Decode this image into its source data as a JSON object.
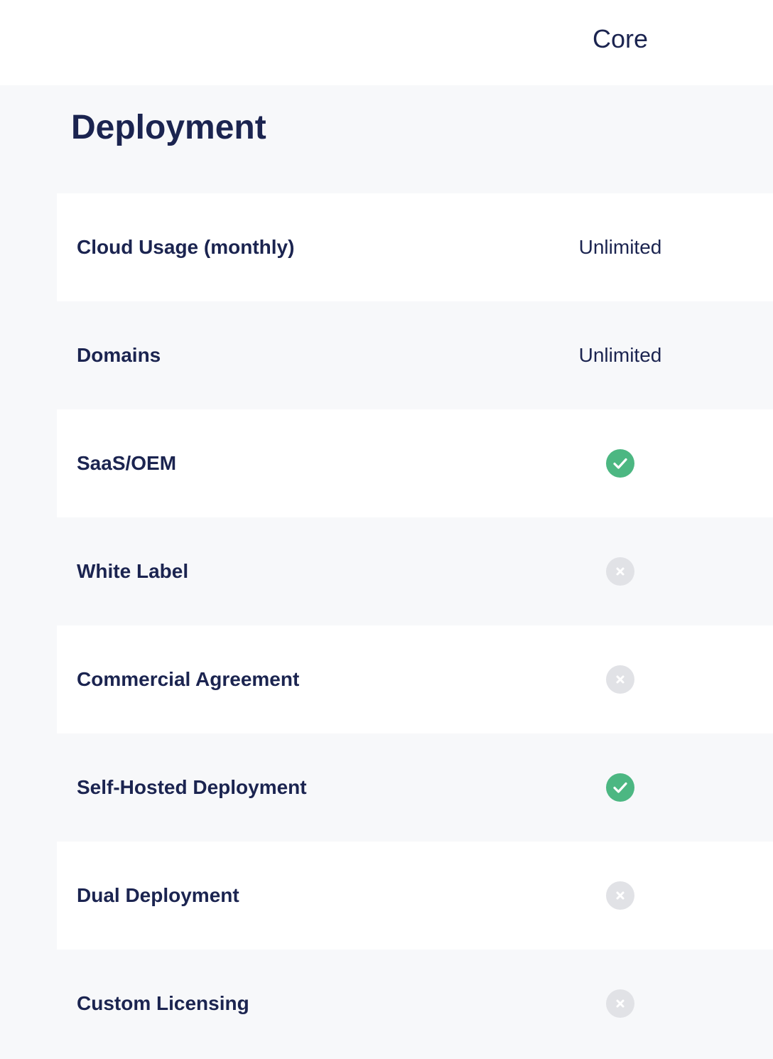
{
  "header": {
    "plan_name": "Core"
  },
  "section": {
    "title": "Deployment",
    "rows": [
      {
        "feature": "Cloud Usage (monthly)",
        "kind": "text",
        "value": "Unlimited"
      },
      {
        "feature": "Domains",
        "kind": "text",
        "value": "Unlimited"
      },
      {
        "feature": "SaaS/OEM",
        "kind": "icon",
        "icon": "check-icon"
      },
      {
        "feature": "White Label",
        "kind": "icon",
        "icon": "cross-icon"
      },
      {
        "feature": "Commercial Agreement",
        "kind": "icon",
        "icon": "cross-icon"
      },
      {
        "feature": "Self-Hosted Deployment",
        "kind": "icon",
        "icon": "check-icon"
      },
      {
        "feature": "Dual Deployment",
        "kind": "icon",
        "icon": "cross-icon"
      },
      {
        "feature": "Custom Licensing",
        "kind": "icon",
        "icon": "cross-icon"
      }
    ]
  },
  "colors": {
    "text": "#1b2450",
    "check": "#4cb782",
    "cross_bg": "#e1e2e6",
    "cross_fg": "#ffffff",
    "row_alt": "#f7f8fa",
    "row": "#ffffff"
  }
}
